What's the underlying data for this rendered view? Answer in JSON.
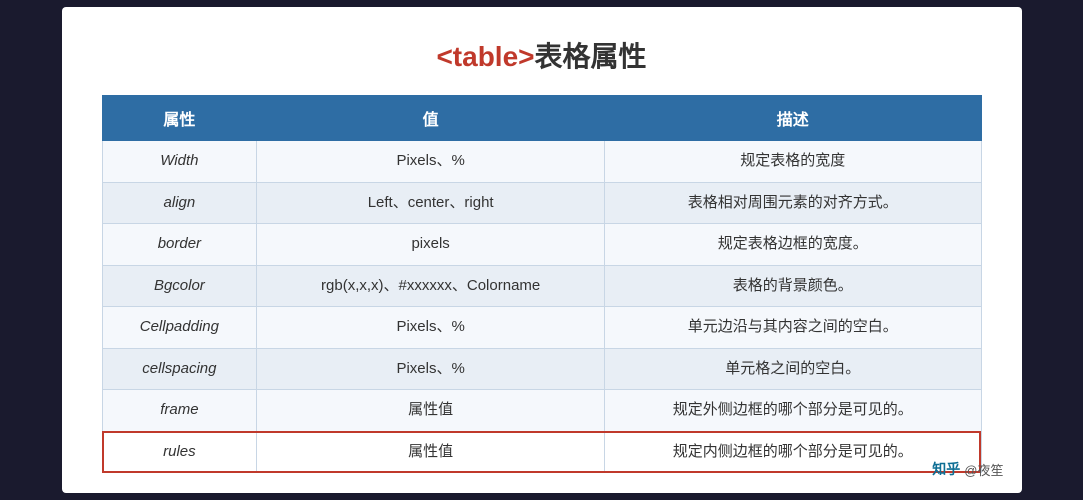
{
  "title": {
    "code": "<table>",
    "cn": "表格属性"
  },
  "table": {
    "headers": [
      "属性",
      "值",
      "描述"
    ],
    "rows": [
      {
        "attr": "Width",
        "value": "Pixels、%",
        "desc": "规定表格的宽度",
        "highlighted": false
      },
      {
        "attr": "align",
        "value": "Left、center、right",
        "desc": "表格相对周围元素的对齐方式。",
        "highlighted": false
      },
      {
        "attr": "border",
        "value": "pixels",
        "desc": "规定表格边框的宽度。",
        "highlighted": false
      },
      {
        "attr": "Bgcolor",
        "value": "rgb(x,x,x)、#xxxxxx、Colorname",
        "desc": "表格的背景颜色。",
        "highlighted": false
      },
      {
        "attr": "Cellpadding",
        "value": "Pixels、%",
        "desc": "单元边沿与其内容之间的空白。",
        "highlighted": false
      },
      {
        "attr": "cellspacing",
        "value": "Pixels、%",
        "desc": "单元格之间的空白。",
        "highlighted": false
      },
      {
        "attr": "frame",
        "value": "属性值",
        "desc": "规定外侧边框的哪个部分是可见的。",
        "highlighted": false
      },
      {
        "attr": "rules",
        "value": "属性值",
        "desc": "规定内侧边框的哪个部分是可见的。",
        "highlighted": true
      }
    ]
  },
  "watermark": {
    "platform": "知乎",
    "username": "@夜笙"
  }
}
